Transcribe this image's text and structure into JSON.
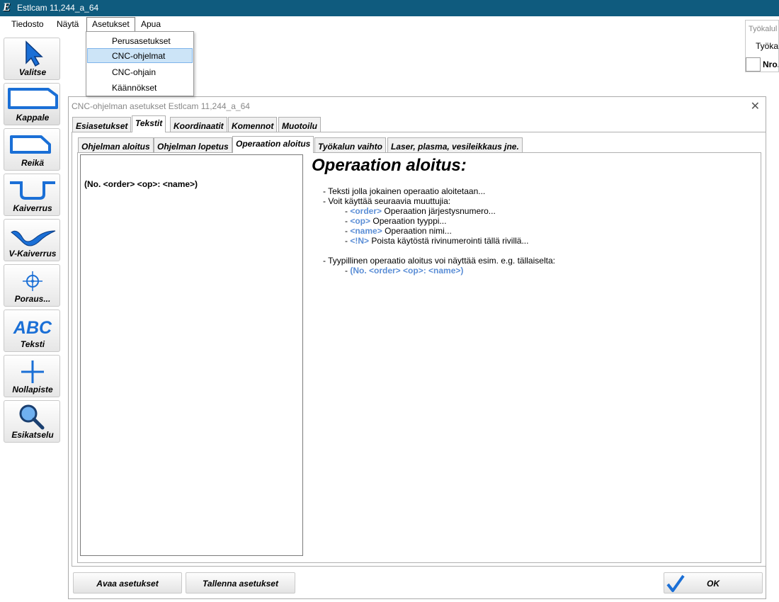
{
  "window": {
    "title": "Estlcam 11,244_a_64"
  },
  "menubar": {
    "items": [
      {
        "label": "Tiedosto"
      },
      {
        "label": "Näytä"
      },
      {
        "label": "Asetukset"
      },
      {
        "label": "Apua"
      }
    ]
  },
  "dropdown": {
    "items": [
      {
        "label": "Perusasetukset"
      },
      {
        "label": "CNC-ohjelmat",
        "selected": true
      },
      {
        "label": "CNC-ohjain"
      },
      {
        "label": "Käännökset"
      }
    ]
  },
  "toolbar": {
    "tools": [
      {
        "label": "Valitse",
        "icon": "cursor-arrow-icon"
      },
      {
        "label": "Kappale",
        "icon": "part-outline-icon"
      },
      {
        "label": "Reikä",
        "icon": "hole-outline-icon"
      },
      {
        "label": "Kaiverrus",
        "icon": "engrave-icon"
      },
      {
        "label": "V-Kaiverrus",
        "icon": "v-carve-icon"
      },
      {
        "label": "Poraus...",
        "icon": "drill-crosshair-icon"
      },
      {
        "label": "Teksti",
        "icon": "abc-text-icon"
      },
      {
        "label": "Nollapiste",
        "icon": "origin-plus-icon"
      },
      {
        "label": "Esikatselu",
        "icon": "magnifier-icon"
      }
    ]
  },
  "right_panel": {
    "title": "Työkalul",
    "tab": "Työkal",
    "column": "Nro."
  },
  "dialog": {
    "title": "CNC-ohjelman asetukset Estlcam 11,244_a_64",
    "main_tabs": [
      {
        "label": "Esiasetukset"
      },
      {
        "label": "Tekstit",
        "active": true
      },
      {
        "label": "Koordinaatit"
      },
      {
        "label": "Komennot"
      },
      {
        "label": "Muotoilu"
      }
    ],
    "sub_tabs": [
      {
        "label": "Ohjelman aloitus"
      },
      {
        "label": "Ohjelman lopetus"
      },
      {
        "label": "Operaation aloitus",
        "active": true
      },
      {
        "label": "Työkalun vaihto"
      },
      {
        "label": "Laser, plasma, vesileikkaus jne."
      }
    ],
    "text_value": "(No. <order> <op>: <name>)",
    "help": {
      "title": "Operaation  aloitus:",
      "line1": "- Teksti jolla jokainen operaatio aloitetaan...",
      "line2": "- Voit käyttää seuraavia muuttujia:",
      "vars": [
        {
          "name": "<order>",
          "desc": "Operaation järjestysnumero..."
        },
        {
          "name": "<op>",
          "desc": "Operaation tyyppi..."
        },
        {
          "name": "<name>",
          "desc": "Operaation nimi..."
        },
        {
          "name": "<!N>",
          "desc": "Poista käytöstä rivinumerointi tällä rivillä..."
        }
      ],
      "line3": "- Tyypillinen operaatio aloitus voi näyttää esim. e.g. tällaiselta:",
      "example": "(No. <order> <op>:  <name>)"
    },
    "buttons": {
      "open": "Avaa asetukset",
      "save": "Tallenna asetukset",
      "ok": "OK"
    }
  },
  "colors": {
    "titlebar": "#0f5b7e",
    "selection": "#cce4f7",
    "variable": "#5b8ed6",
    "icon_blue": "#1a6fd6"
  }
}
